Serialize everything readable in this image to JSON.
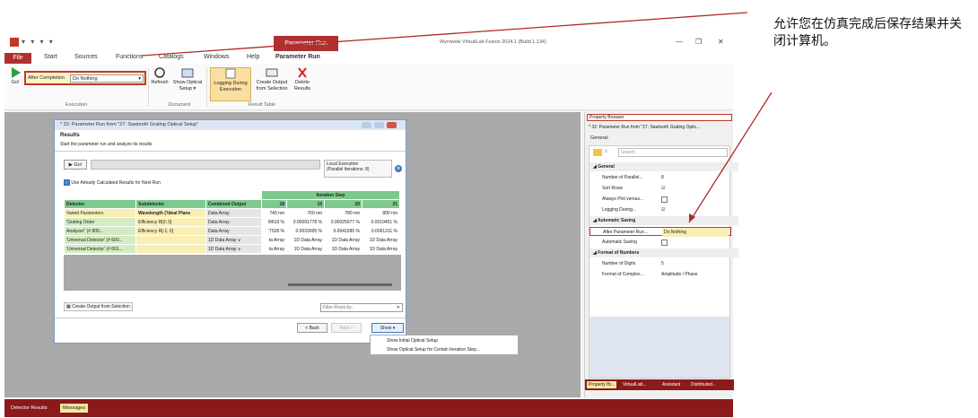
{
  "app": {
    "context_tab": "Parameter Run",
    "title": "Wyrowski VirtualLab Fusion 2024.1 (Build 1.134)",
    "quick_access": "▾ ▾ ▾ ▾"
  },
  "menu": {
    "file": "File",
    "items": [
      "Start",
      "Sources",
      "Functions",
      "Catalogs",
      "Windows",
      "Help",
      "Parameter Run"
    ]
  },
  "ribbon": {
    "go": "Go!",
    "after_completion_label": "After Completion",
    "after_completion_value": "Do Nothing",
    "refresh": "Refresh",
    "show_optical_setup": "Show Optical Setup ▾",
    "logging": "Logging During Execution",
    "create_output": "Create Output from Selection",
    "delete_results": "Delete Results",
    "groups": {
      "execution": "Execution",
      "document": "Document",
      "result_table": "Result Table"
    }
  },
  "dialog": {
    "title": "* 32: Parameter Run from \"27: Sawtooth Grating Optical Setup\"",
    "section": "Results",
    "subtitle": "Start the parameter run and analyze its results",
    "go": "Go!",
    "local_exec_line1": "Local Execution",
    "local_exec_line2": "(Parallel Iterations: 8)",
    "use_calc": "Use Already Calculated Results for Next Run",
    "create_output": "Create Output from Selection",
    "filter_placeholder": "Filter Rows by...",
    "back": "< Back",
    "next": "Next >",
    "show": "Show ▾",
    "menu_item1": "Show Initial Optical Setup",
    "menu_item2": "Show Optical Setup for Certain Iteration Step..."
  },
  "table": {
    "iteration_header": "Iteration Step",
    "headers": [
      "Detector",
      "Subdetector",
      "Combined Output",
      "18",
      "19",
      "20",
      "21"
    ],
    "rows": [
      [
        "Varied Parameters",
        "Wavelength ('Ideal Plane",
        "Data Array",
        "740 nm",
        "760 nm",
        "780 nm",
        "800 nm"
      ],
      [
        "'Grating Order",
        "Efficiency R[0; 0]",
        "Data Array",
        "l9619 %",
        "0.00091778 %",
        "0.00025977 %",
        "0.0010451 %"
      ],
      [
        "Analyzer\"  (# 800...",
        "Efficiency R[-1; 0]",
        "Data Array",
        "'7528 %",
        "0.0033005 %",
        "0.0041585 %",
        "0.0061311 %"
      ],
      [
        "'Universal Detector' (# 600...",
        "",
        "1D Data Array ∨",
        "ta Array",
        "1D Data Array",
        "1D Data Array",
        "1D Data Array"
      ],
      [
        "'Universal Detector' (# 601...",
        "",
        "1D Data Array ∨",
        "ta Array",
        "1D Data Array",
        "1D Data Array",
        "1D Data Array"
      ]
    ]
  },
  "property_browser": {
    "title": "Property Browser",
    "document": "* 32: Parameter Run from \"27: Sawtooth Grating Optic...",
    "tab": "General",
    "search_placeholder": "Search",
    "sections": {
      "general": "General",
      "saving": "Automatic Saving",
      "numbers": "Format of Numbers"
    },
    "rows": {
      "parallel": {
        "label": "Number of Parallel...",
        "value": "8"
      },
      "sort": {
        "label": "Sort Rows",
        "value": "☑"
      },
      "always_plot": {
        "label": "Always Plot versus...",
        "value": ""
      },
      "logging": {
        "label": "Logging During...",
        "value": "☑"
      },
      "after_run": {
        "label": "After Parameter Run...",
        "value": "Do Nothing"
      },
      "auto_saving": {
        "label": "Automatic Saving",
        "value": ""
      },
      "digits": {
        "label": "Number of Digits",
        "value": "5"
      },
      "complex": {
        "label": "Format of Complex...",
        "value": "Amplitude / Phase"
      }
    },
    "bottom_tabs": [
      "Property Br...",
      "VirtualLab...",
      "Assistant",
      "Distributed..."
    ]
  },
  "status": {
    "tabs": [
      "Detector Results",
      "Messages"
    ]
  },
  "annotation": {
    "text": "允许您在仿真完成后保存结果并关闭计算机。"
  },
  "colors": {
    "brand": "#b03030",
    "highlight": "#c0392b",
    "grid_header": "#7ec98e"
  }
}
